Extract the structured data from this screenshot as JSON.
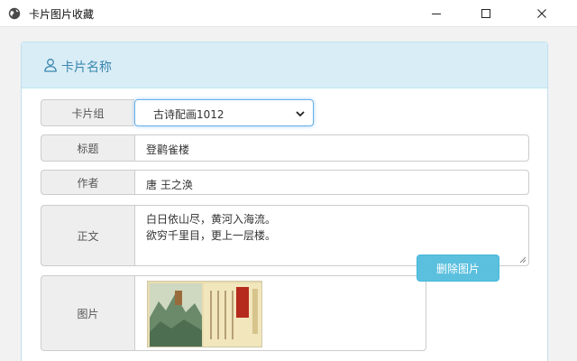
{
  "window": {
    "title": "卡片图片收藏",
    "icon": "globe-icon",
    "controls": [
      "minimize-icon",
      "maximize-icon",
      "close-icon"
    ]
  },
  "panel": {
    "title": "卡片名称",
    "icon": "user-icon",
    "heading_color": "#d9edf7",
    "heading_text_color": "#3a87ad"
  },
  "form": {
    "group_label": "卡片组",
    "group_value": "古诗配画1012",
    "title_label": "标题",
    "title_value": "登鹳雀楼",
    "author_label": "作者",
    "author_value": "唐 王之涣",
    "body_label": "正文",
    "body_lines": [
      "白日依山尽，黄河入海流。",
      "欲穷千里目，更上一层楼。"
    ],
    "image_label": "图片",
    "delete_button": "删除图片",
    "delete_button_color": "#5bc0de"
  }
}
